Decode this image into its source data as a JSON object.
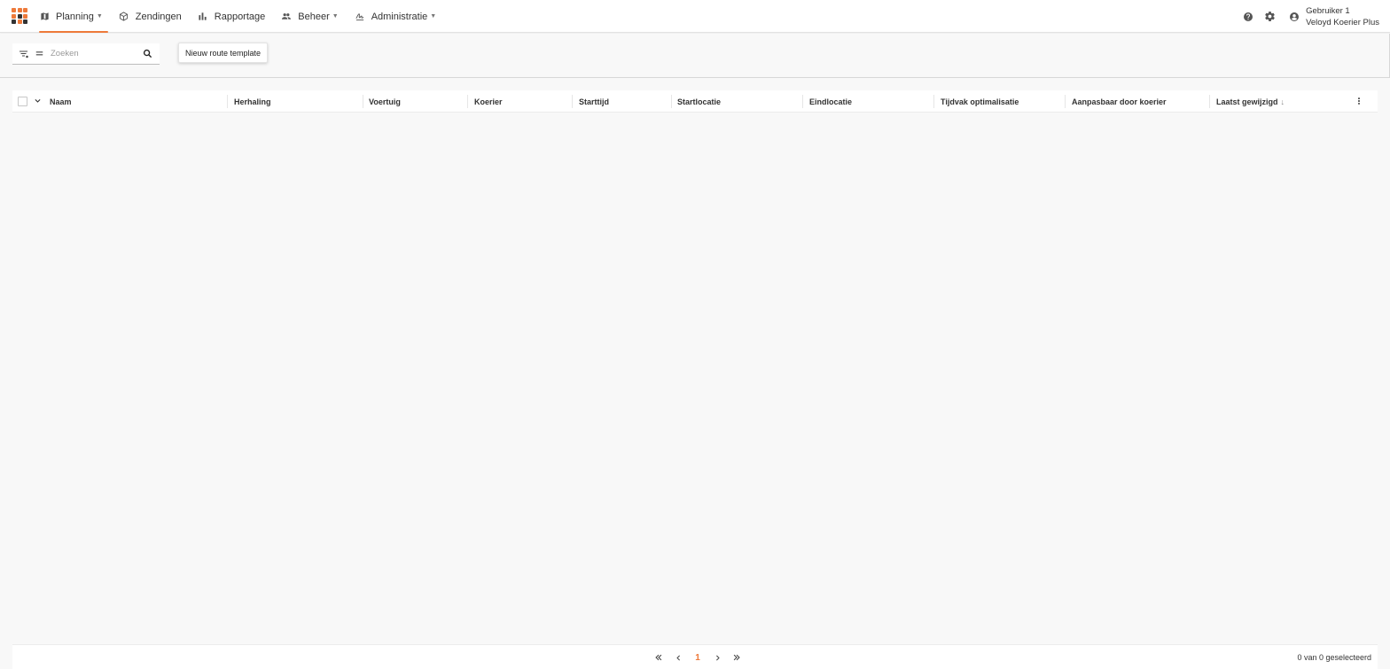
{
  "brand": {
    "accent": "#ee7a3a",
    "logo_colors": [
      "#ee7a3a",
      "#ee7a3a",
      "#ee7a3a",
      "#ee7a3a",
      "#333333",
      "#ee7a3a",
      "#333333",
      "#ee7a3a",
      "#333333"
    ]
  },
  "nav": {
    "items": [
      {
        "label": "Planning",
        "icon": "map-icon",
        "has_dropdown": true,
        "active": true
      },
      {
        "label": "Zendingen",
        "icon": "package-icon",
        "has_dropdown": false,
        "active": false
      },
      {
        "label": "Rapportage",
        "icon": "bar-chart-icon",
        "has_dropdown": false,
        "active": false
      },
      {
        "label": "Beheer",
        "icon": "group-icon",
        "has_dropdown": true,
        "active": false
      },
      {
        "label": "Administratie",
        "icon": "signature-icon",
        "has_dropdown": true,
        "active": false
      }
    ]
  },
  "user": {
    "name": "Gebruiker 1",
    "organization": "Veloyd Koerier Plus"
  },
  "toolbar": {
    "search_placeholder": "Zoeken",
    "search_value": "",
    "new_button_label": "Nieuw route template"
  },
  "table": {
    "columns": [
      "Naam",
      "Herhaling",
      "Voertuig",
      "Koerier",
      "Starttijd",
      "Startlocatie",
      "Eindlocatie",
      "Tijdvak optimalisatie",
      "Aanpasbaar door koerier",
      "Laatst gewijzigd"
    ],
    "sort_indicator": "↓",
    "rows": []
  },
  "pagination": {
    "current_page": "1",
    "selected_text": "0 van 0 geselecteerd"
  }
}
